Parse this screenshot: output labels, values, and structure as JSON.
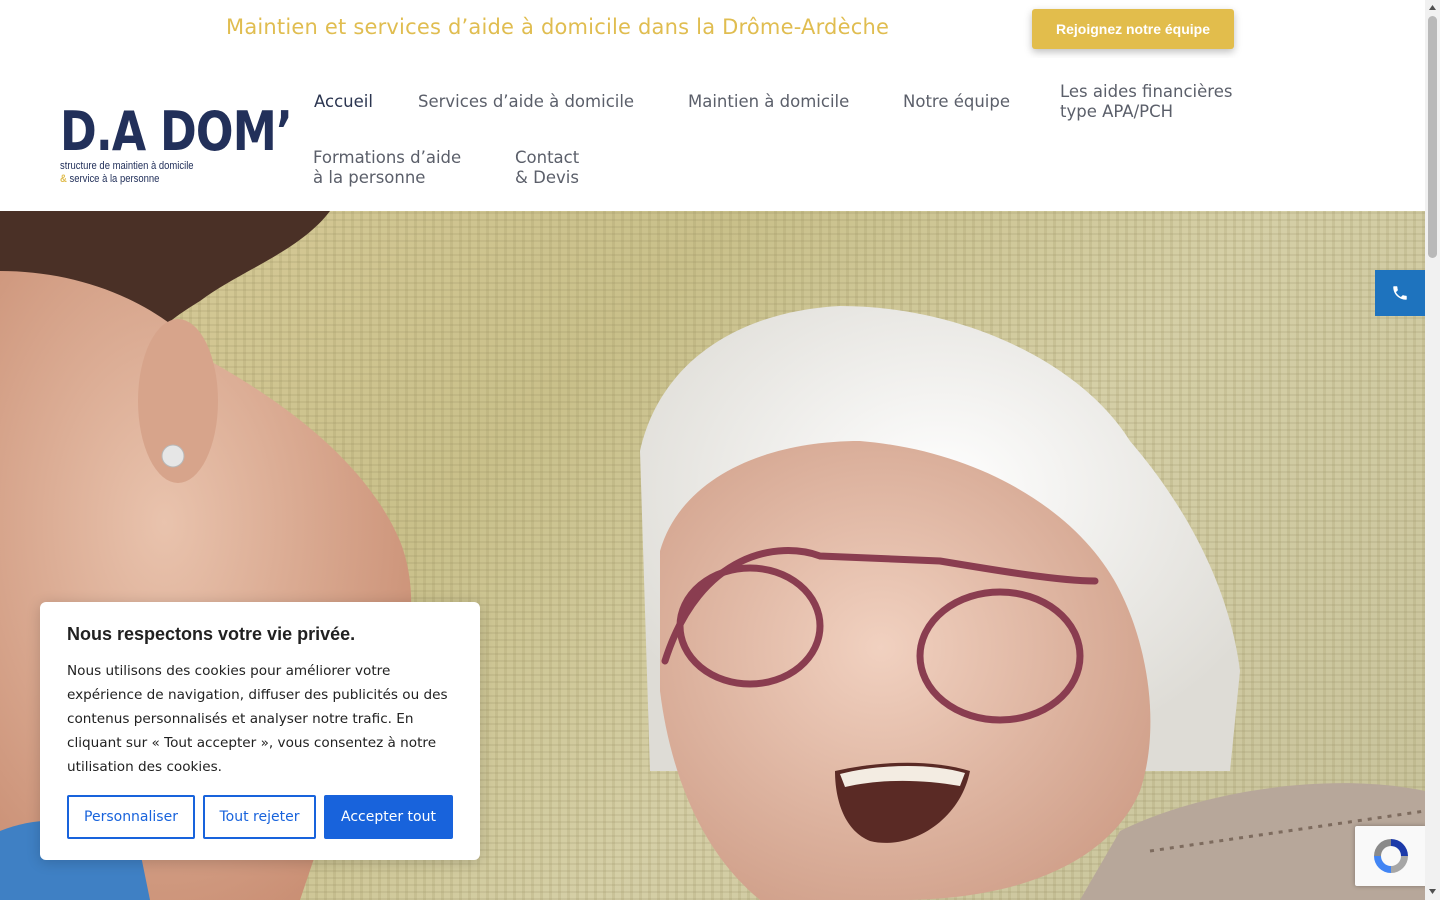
{
  "topbar": {
    "tagline": "Maintien et services d’aide à domicile dans la Drôme-Ardèche",
    "join_button": "Rejoignez notre équipe"
  },
  "logo": {
    "main": "D.A DOM",
    "apostrophe": "’",
    "sub_line1": "structure de maintien à domicile",
    "sub_amp": "&",
    "sub_line2": "service à la personne"
  },
  "nav": {
    "home": "Accueil",
    "services": "Services d’aide à domicile",
    "maintien": "Maintien à domicile",
    "team": "Notre équipe",
    "aides_line1": "Les aides financières",
    "aides_line2": "type APA/PCH",
    "formations_line1": "Formations d’aide",
    "formations_line2": "à la personne",
    "contact_line1": "Contact",
    "contact_line2": "& Devis"
  },
  "floating": {
    "phone_icon": "phone-icon"
  },
  "cookie": {
    "title": "Nous respectons votre vie privée.",
    "text": "Nous utilisons des cookies pour améliorer votre expérience de navigation, diffuser des publicités ou des contenus personnalisés et analyser notre trafic. En cliquant sur « Tout accepter », vous consentez à notre utilisation des cookies.",
    "customize": "Personnaliser",
    "reject": "Tout rejeter",
    "accept": "Accepter tout"
  },
  "colors": {
    "accent_gold": "#e0bd50",
    "brand_navy": "#22305a",
    "cookie_blue": "#1863dc",
    "phone_blue": "#1e73be"
  }
}
